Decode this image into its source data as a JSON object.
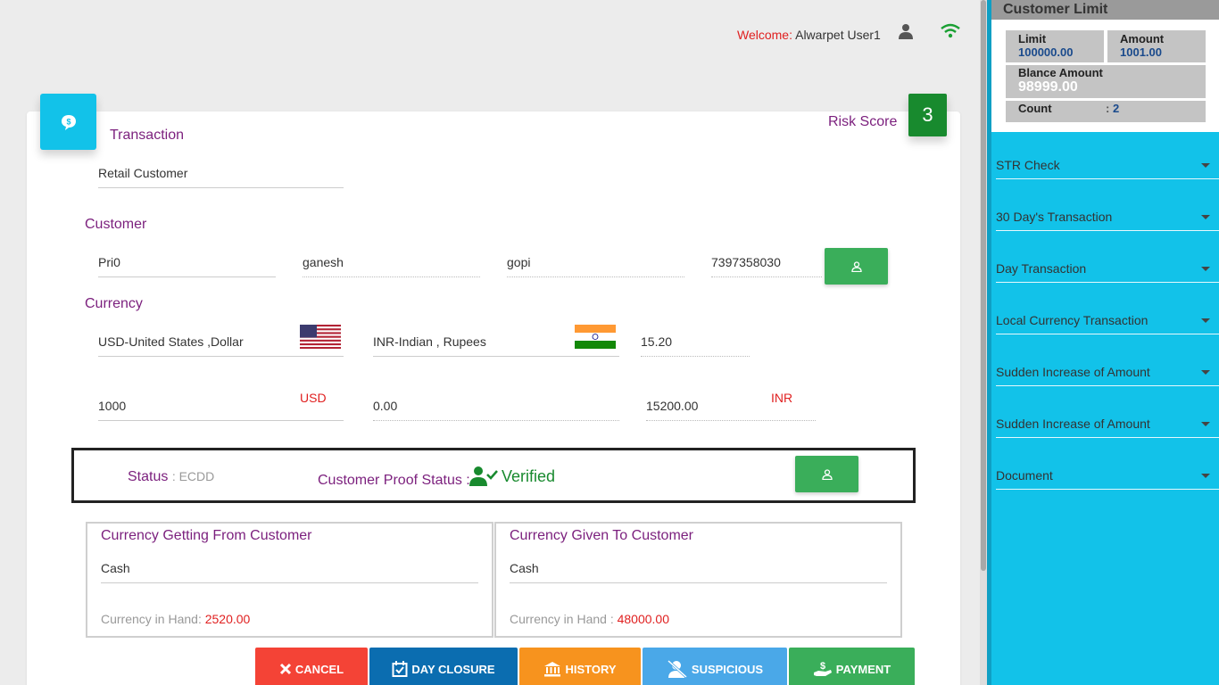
{
  "header": {
    "welcome_label": "Welcome:",
    "user_name": "Alwarpet User1"
  },
  "transaction": {
    "title": "Transaction",
    "type_value": "Retail Customer",
    "risk_label": "Risk Score",
    "risk_score": "3"
  },
  "customer": {
    "title": "Customer",
    "code": "Pri0",
    "first_name": "ganesh",
    "last_name": "gopi",
    "phone": "7397358030"
  },
  "currency": {
    "title": "Currency",
    "from_currency": "USD-United States ,Dollar",
    "to_currency": "INR-Indian , Rupees",
    "rate": "15.20",
    "from_amount": "1000",
    "from_unit": "USD",
    "middle_amount": "0.00",
    "to_amount": "15200.00",
    "to_unit": "INR"
  },
  "status": {
    "status_label": "Status",
    "status_value": "ECDD",
    "proof_label": "Customer Proof Status",
    "proof_value": "Verified"
  },
  "getting": {
    "title": "Currency Getting From Customer",
    "mode": "Cash",
    "hand_label": "Currency in Hand:",
    "hand_value": "2520.00"
  },
  "given": {
    "title": "Currency Given To Customer",
    "mode": "Cash",
    "hand_label": "Currency in Hand :",
    "hand_value": "48000.00"
  },
  "actions": {
    "cancel": "CANCEL",
    "day_closure": "DAY CLOSURE",
    "history": "HISTORY",
    "suspicious": "SUSPICIOUS",
    "payment": "PAYMENT"
  },
  "customer_limit": {
    "title": "Customer Limit",
    "limit_label": "Limit",
    "limit_value": "100000.00",
    "amount_label": "Amount",
    "amount_value": "1001.00",
    "balance_label": "Blance Amount",
    "balance_value": "98999.00",
    "count_label": "Count",
    "count_value": "2"
  },
  "sidebar_menu": [
    {
      "label": "STR Check"
    },
    {
      "label": "30 Day's Transaction"
    },
    {
      "label": "Day Transaction"
    },
    {
      "label": "Local Currency Transaction"
    },
    {
      "label": "Sudden Increase of Amount"
    },
    {
      "label": "Sudden Increase of Amount"
    },
    {
      "label": "Document"
    }
  ],
  "colors": {
    "accent": "#12c2e9",
    "title_purple": "#7b1f7d",
    "success": "#3aae5a",
    "danger": "#f44336",
    "primary": "#0b6db0",
    "warning": "#f7931e",
    "info": "#4aa8e8"
  }
}
